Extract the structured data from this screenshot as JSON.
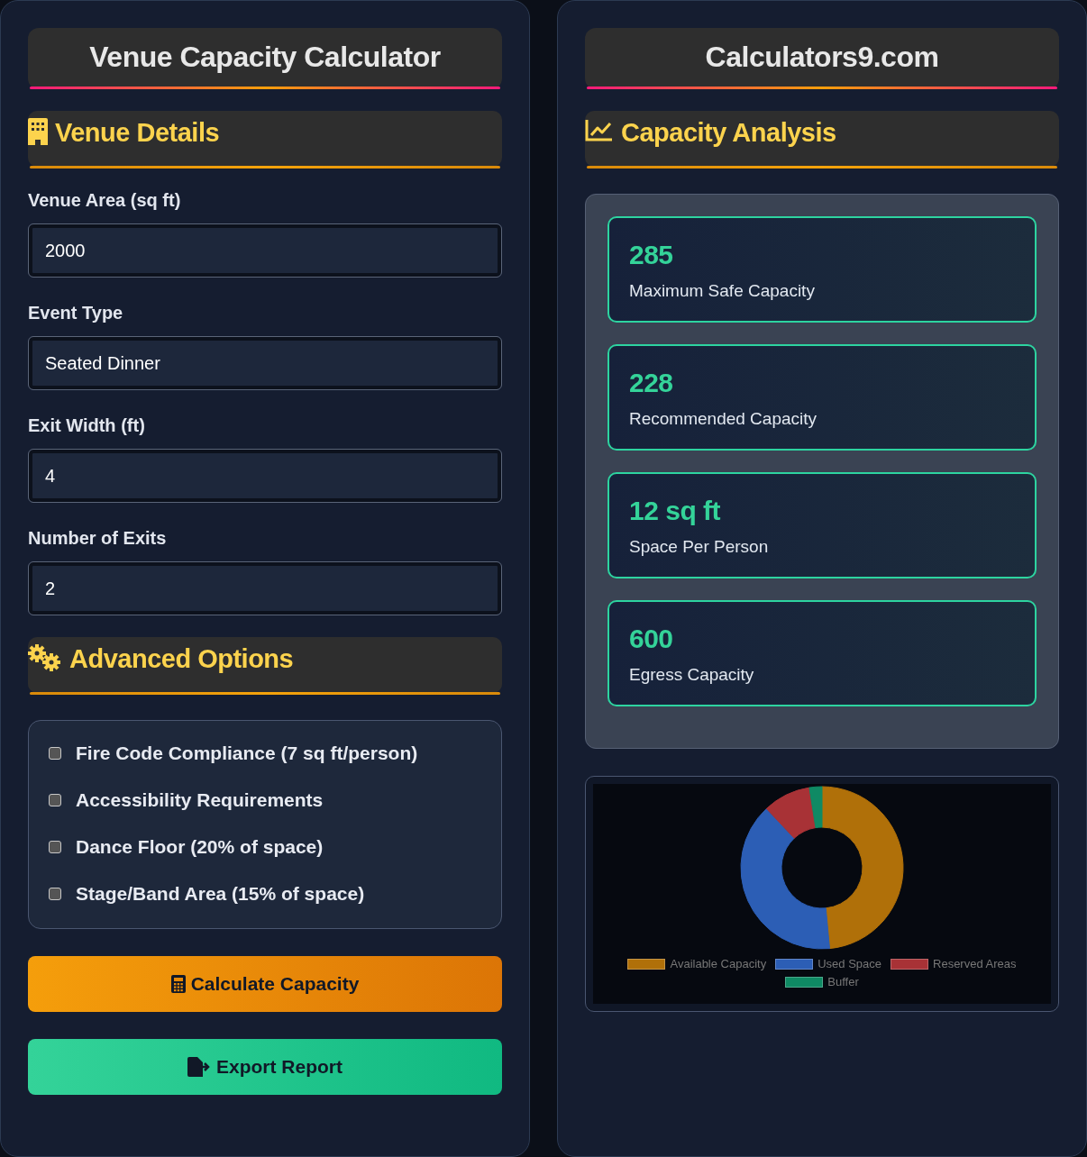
{
  "left_panel": {
    "title": "Venue Capacity Calculator",
    "venue_details": {
      "heading": "Venue Details",
      "fields": [
        {
          "label": "Venue Area (sq ft)",
          "value": "2000"
        },
        {
          "label": "Event Type",
          "value": "Seated Dinner"
        },
        {
          "label": "Exit Width (ft)",
          "value": "4"
        },
        {
          "label": "Number of Exits",
          "value": "2"
        }
      ]
    },
    "advanced_options": {
      "heading": "Advanced Options",
      "options": [
        {
          "label": "Fire Code Compliance (7 sq ft/person)",
          "checked": false
        },
        {
          "label": "Accessibility Requirements",
          "checked": false
        },
        {
          "label": "Dance Floor (20% of space)",
          "checked": false
        },
        {
          "label": "Stage/Band Area (15% of space)",
          "checked": false
        }
      ]
    },
    "buttons": [
      {
        "label": "Calculate Capacity",
        "kind": "calculate"
      },
      {
        "label": "Export Report",
        "kind": "export"
      }
    ]
  },
  "right_panel": {
    "title": "Calculators9.com",
    "capacity_analysis": {
      "heading": "Capacity Analysis",
      "results": [
        {
          "value": "285",
          "label": "Maximum Safe Capacity"
        },
        {
          "value": "228",
          "label": "Recommended Capacity"
        },
        {
          "value": "12 sq ft",
          "label": "Space Per Person"
        },
        {
          "value": "600",
          "label": "Egress Capacity"
        }
      ]
    },
    "chart": {
      "legend": [
        {
          "label": "Available Capacity",
          "color": "#b07009"
        },
        {
          "label": "Used Space",
          "color": "#2c5eb5"
        },
        {
          "label": "Reserved Areas",
          "color": "#a83236"
        },
        {
          "label": "Buffer",
          "color": "#0f8a64"
        }
      ]
    }
  }
}
